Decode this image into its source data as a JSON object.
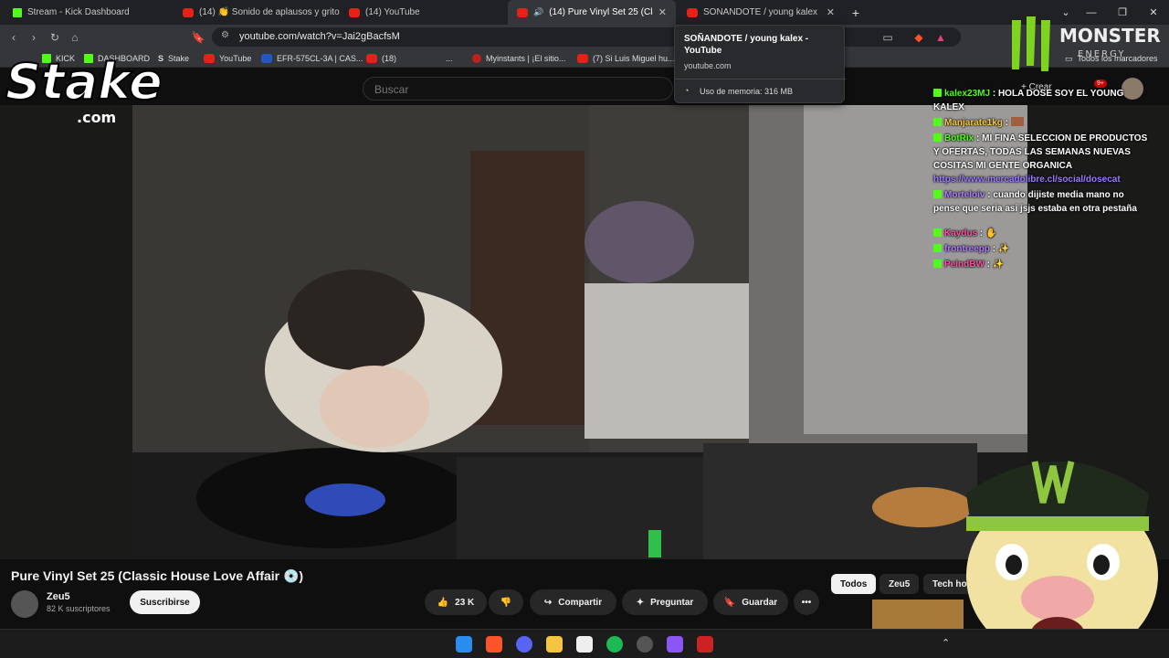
{
  "browser": {
    "tabs": [
      {
        "label": "Stream - Kick Dashboard",
        "favicon": "kick-icon",
        "active": false
      },
      {
        "label": "(14) 👏 Sonido de aplausos y gritos ...",
        "favicon": "youtube-icon",
        "active": false
      },
      {
        "label": "(14) YouTube",
        "favicon": "youtube-icon",
        "active": false
      },
      {
        "label": "(14) Pure Vinyl Set 25 (Classic...",
        "favicon": "youtube-icon",
        "active": true
      },
      {
        "label": "SOÑANDOTE / young kalex - Yo...",
        "favicon": "youtube-icon",
        "active": false
      }
    ],
    "url": "youtube.com/watch?v=Jai2gBacfsM",
    "bookmarks": [
      "KICK",
      "DASHBOARD",
      "Stake",
      "YouTube",
      "EFR-575CL-3A | CAS...",
      "(18)",
      "...",
      "Myinstants | ¡El sitio...",
      "(7) Si Luis Miguel hu..."
    ],
    "all_bookmarks": "Todos los marcadores",
    "tab_hover": {
      "title": "SOÑANDOTE / young kalex - YouTube",
      "domain": "youtube.com",
      "memory": "Uso de memoria: 316 MB"
    }
  },
  "youtube": {
    "search_placeholder": "Buscar",
    "create_label": "+ Crear",
    "notifications": "9+",
    "video_title": "Pure Vinyl Set 25 (Classic House Love Affair 💿)",
    "channel": "Zeu5",
    "subscribers": "82 K suscriptores",
    "subscribe": "Suscribirse",
    "likes": "23 K",
    "share": "Compartir",
    "ask": "Preguntar",
    "save": "Guardar",
    "chips": [
      "Todos",
      "Zeu5",
      "Tech ho"
    ]
  },
  "overlay": {
    "stake_logo_text": "Stake",
    "stake_logo_sub": ".com",
    "monster_text": "MONSTER",
    "monster_sub": "ENERGY",
    "chat": [
      {
        "user": "kalex23MJ",
        "color": "#53fc18",
        "text": "HOLA DOSE SOY EL YOUNG KALEX"
      },
      {
        "user": "Manjarate1kg",
        "color": "#f5c542",
        "text": ""
      },
      {
        "user": "BotRix",
        "color": "#53fc18",
        "text": "MI FINA SELECCION DE PRODUCTOS Y OFERTAS, TODAS LAS SEMANAS NUEVAS COSITAS MI GENTE ORGANICA",
        "link": "https://www.mercadolibre.cl/social/dosecat"
      },
      {
        "user": "Morteloiv",
        "color": "#b07cff",
        "text": "cuando dijiste media mano no pense que seria asi jsjs estaba en otra pestaña"
      },
      {
        "user": "Kaydus",
        "color": "#ff4fa3",
        "text": ""
      },
      {
        "user": "frontreepp",
        "color": "#b07cff",
        "text": ""
      },
      {
        "user": "PeindBW",
        "color": "#ff4fa3",
        "text": ""
      }
    ]
  },
  "colors": {
    "kick_green": "#53fc18",
    "youtube_red": "#e62117",
    "monster_green": "#7ed321"
  }
}
